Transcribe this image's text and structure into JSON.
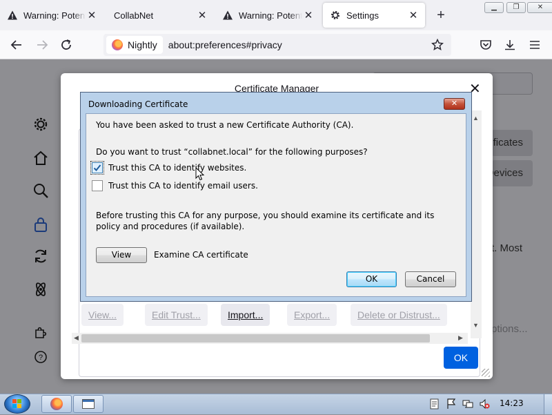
{
  "tabs": [
    {
      "title": "Warning: Potential Security Risk Ahead",
      "icon": "warning-icon",
      "active": false
    },
    {
      "title": "CollabNet",
      "icon": "",
      "active": false
    },
    {
      "title": "Warning: Potential Security Risk Ahead",
      "icon": "warning-icon",
      "active": false
    },
    {
      "title": "Settings",
      "icon": "gear-icon",
      "active": true
    }
  ],
  "toolbar": {
    "identity_label": "Nightly",
    "url": "about:preferences#privacy"
  },
  "prefs": {
    "right_buttons": [
      "View Certificates...",
      "Security Devices..."
    ],
    "partial_text": "t. Most",
    "partial_text_2": "ptions..."
  },
  "cert_manager": {
    "title": "Certificate Manager",
    "buttons": {
      "view": "View...",
      "edit_trust": "Edit Trust...",
      "import": "Import...",
      "export": "Export...",
      "delete": "Delete or Distrust..."
    },
    "ok": "OK"
  },
  "dialog": {
    "title": "Downloading Certificate",
    "intro": "You have been asked to trust a new Certificate Authority (CA).",
    "question": "Do you want to trust “collabnet.local” for the following purposes?",
    "options": [
      {
        "label": "Trust this CA to identify websites.",
        "checked": true
      },
      {
        "label": "Trust this CA to identify email users.",
        "checked": false
      }
    ],
    "advice": "Before trusting this CA for any purpose, you should examine its certificate and its policy and procedures (if available).",
    "view_button": "View",
    "view_caption": "Examine CA certificate",
    "ok": "OK",
    "cancel": "Cancel"
  },
  "taskbar": {
    "time": "14:23"
  },
  "colors": {
    "accent": "#0061e0",
    "dialog_frame": "#b9d1ea",
    "close_red": "#c4523a"
  }
}
